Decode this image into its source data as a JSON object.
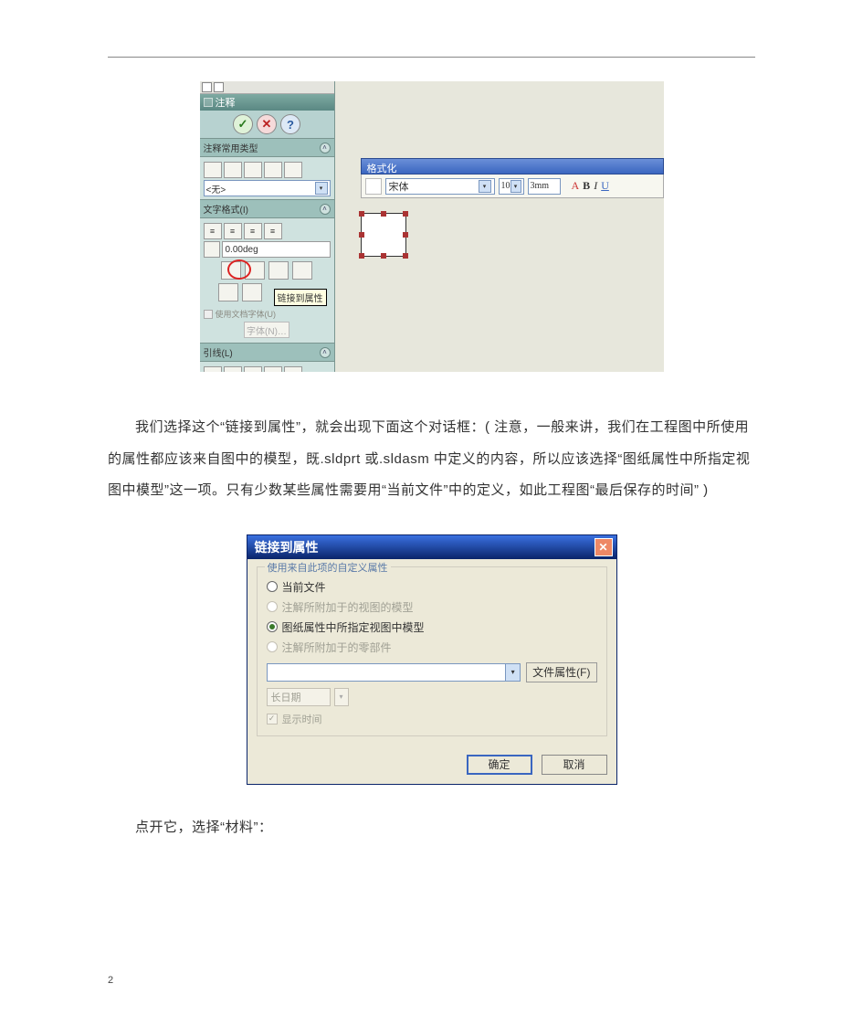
{
  "page_number": "2",
  "paragraph1": "我们选择这个“链接到属性”，就会出现下面这个对话框：( 注意，一般来讲，我们在工程图中所使用的属性都应该来自图中的模型，既.sldprt 或.sldasm 中定义的内容，所以应该选择“图纸属性中所指定视图中模型”这一项。只有少数某些属性需要用“当前文件”中的定义，如此工程图“最后保存的时间” )",
  "paragraph2": "点开它，选择“材料”：",
  "fig1": {
    "panel_title": "注释",
    "section_common": "注释常用类型",
    "common_value": "<无>",
    "section_textfmt": "文字格式(I)",
    "angle_value": "0.00deg",
    "tooltip": "链接到属性",
    "use_doc_font": "使用文档字体(U)",
    "font_btn": "字体(N)…",
    "section_leader": "引线(L)",
    "format_bar_title": "格式化",
    "font_name": "宋体",
    "font_size": "10",
    "font_unit": "3mm",
    "style_a": "A",
    "style_b": "B",
    "style_i": "I",
    "style_u": "U"
  },
  "dialog": {
    "title": "链接到属性",
    "group_label": "使用来自此项的自定义属性",
    "radio1": "当前文件",
    "radio2": "注解所附加于的视图的模型",
    "radio3": "图纸属性中所指定视图中模型",
    "radio4": "注解所附加于的零部件",
    "file_props_btn": "文件属性(F)",
    "date_format": "长日期",
    "show_time": "显示时间",
    "ok": "确定",
    "cancel": "取消"
  }
}
